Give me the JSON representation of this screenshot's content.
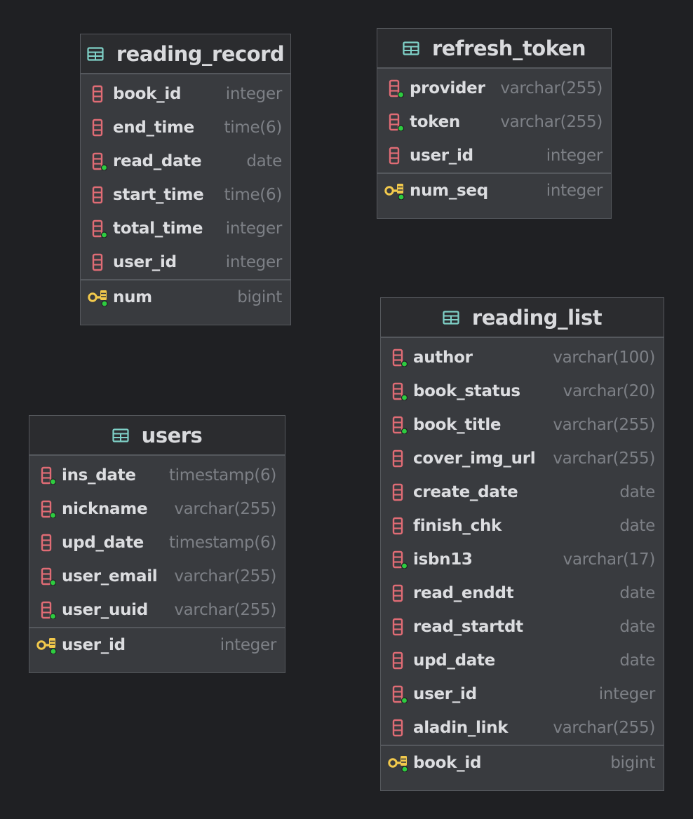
{
  "colors": {
    "background": "#1f2023",
    "table_body": "#393b3f",
    "table_header": "#2b2c2f",
    "column_icon": "#e06c75",
    "key_icon": "#f2c94c",
    "index_dot": "#2ecc40",
    "table_icon": "#7fd1c8"
  },
  "tables": {
    "reading_record": {
      "name": "reading_record",
      "columns": [
        {
          "name": "book_id",
          "type": "integer",
          "indexed": false
        },
        {
          "name": "end_time",
          "type": "time(6)",
          "indexed": false
        },
        {
          "name": "read_date",
          "type": "date",
          "indexed": true
        },
        {
          "name": "start_time",
          "type": "time(6)",
          "indexed": false
        },
        {
          "name": "total_time",
          "type": "integer",
          "indexed": true
        },
        {
          "name": "user_id",
          "type": "integer",
          "indexed": false
        }
      ],
      "pk": {
        "name": "num",
        "type": "bigint"
      }
    },
    "refresh_token": {
      "name": "refresh_token",
      "columns": [
        {
          "name": "provider",
          "type": "varchar(255)",
          "indexed": true
        },
        {
          "name": "token",
          "type": "varchar(255)",
          "indexed": true
        },
        {
          "name": "user_id",
          "type": "integer",
          "indexed": false
        }
      ],
      "pk": {
        "name": "num_seq",
        "type": "integer"
      }
    },
    "users": {
      "name": "users",
      "columns": [
        {
          "name": "ins_date",
          "type": "timestamp(6)",
          "indexed": true
        },
        {
          "name": "nickname",
          "type": "varchar(255)",
          "indexed": true
        },
        {
          "name": "upd_date",
          "type": "timestamp(6)",
          "indexed": false
        },
        {
          "name": "user_email",
          "type": "varchar(255)",
          "indexed": true
        },
        {
          "name": "user_uuid",
          "type": "varchar(255)",
          "indexed": true
        }
      ],
      "pk": {
        "name": "user_id",
        "type": "integer"
      }
    },
    "reading_list": {
      "name": "reading_list",
      "columns": [
        {
          "name": "author",
          "type": "varchar(100)",
          "indexed": true
        },
        {
          "name": "book_status",
          "type": "varchar(20)",
          "indexed": true
        },
        {
          "name": "book_title",
          "type": "varchar(255)",
          "indexed": true
        },
        {
          "name": "cover_img_url",
          "type": "varchar(255)",
          "indexed": false
        },
        {
          "name": "create_date",
          "type": "date",
          "indexed": false
        },
        {
          "name": "finish_chk",
          "type": "date",
          "indexed": false
        },
        {
          "name": "isbn13",
          "type": "varchar(17)",
          "indexed": true
        },
        {
          "name": "read_enddt",
          "type": "date",
          "indexed": false
        },
        {
          "name": "read_startdt",
          "type": "date",
          "indexed": false
        },
        {
          "name": "upd_date",
          "type": "date",
          "indexed": false
        },
        {
          "name": "user_id",
          "type": "integer",
          "indexed": true
        },
        {
          "name": "aladin_link",
          "type": "varchar(255)",
          "indexed": false
        }
      ],
      "pk": {
        "name": "book_id",
        "type": "bigint"
      }
    }
  }
}
